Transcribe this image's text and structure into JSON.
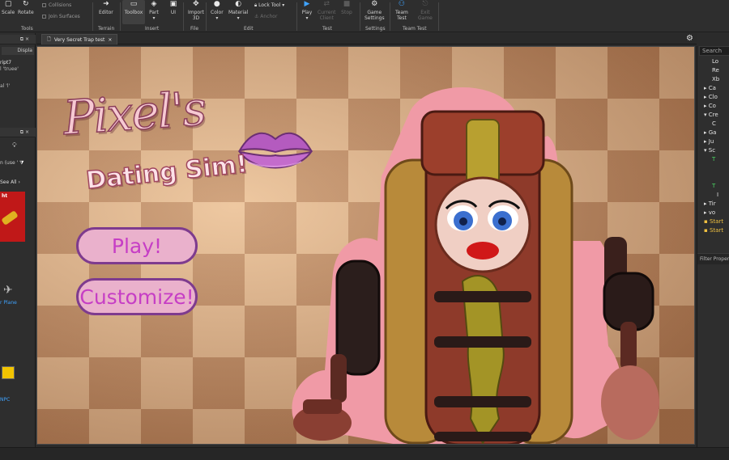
{
  "ribbon": {
    "scale": "Scale",
    "rotate": "Rotate",
    "collisions": "Collisions",
    "join_surfaces": "Join Surfaces",
    "editor": "Editor",
    "toolbox": "Toolbox",
    "part": "Part",
    "ui": "UI",
    "import3d_1": "Import",
    "import3d_2": "3D",
    "color": "Color",
    "material": "Material",
    "lock_tool": "Lock Tool",
    "anchor": "Anchor",
    "play": "Play",
    "current_client_1": "Current",
    "current_client_2": "Client",
    "stop": "Stop",
    "game_settings_1": "Game",
    "game_settings_2": "Settings",
    "team_test_1": "Team",
    "team_test_2": "Test",
    "exit_game_1": "Exit",
    "exit_game_2": "Game",
    "groups": {
      "tools": "Tools",
      "terrain": "Terrain",
      "insert": "Insert",
      "file": "File",
      "edit": "Edit",
      "test": "Test",
      "settings": "Settings",
      "team_test": "Team Test"
    }
  },
  "left": {
    "panel1_tab": "Displa",
    "script_name": "ript7",
    "script_line1": "l 'truee'",
    "script_line2": "al 'l'",
    "search_hint": "n (use '",
    "see_all": "See All ›",
    "asset1_label": "ht",
    "asset2_label": "r Plane",
    "asset3_label": "NPC"
  },
  "document": {
    "tab_title": "Very Secret Trap test",
    "close": "×"
  },
  "game": {
    "logo_title": "Pixel's",
    "logo_subtitle": "Dating Sim!",
    "play_button": "Play!",
    "customize_button": "Customize!"
  },
  "explorer": {
    "search_placeholder": "Search",
    "items": [
      "Lo",
      "Re",
      "Xb",
      "Ca",
      "Clo",
      "Co",
      "Cre",
      "C",
      "Ga",
      "Ju",
      "Sc",
      "T",
      "",
      "",
      "T",
      "I",
      "Tir",
      "vo",
      "Start",
      "Start"
    ],
    "filter_properties": "Filter Proper"
  },
  "colors": {
    "button_fill": "#eab1cc",
    "button_border": "#7e3b8e",
    "button_text": "#c63ec5",
    "studio_bg": "#2e2e2e",
    "play_blue": "#3fa3ff"
  }
}
